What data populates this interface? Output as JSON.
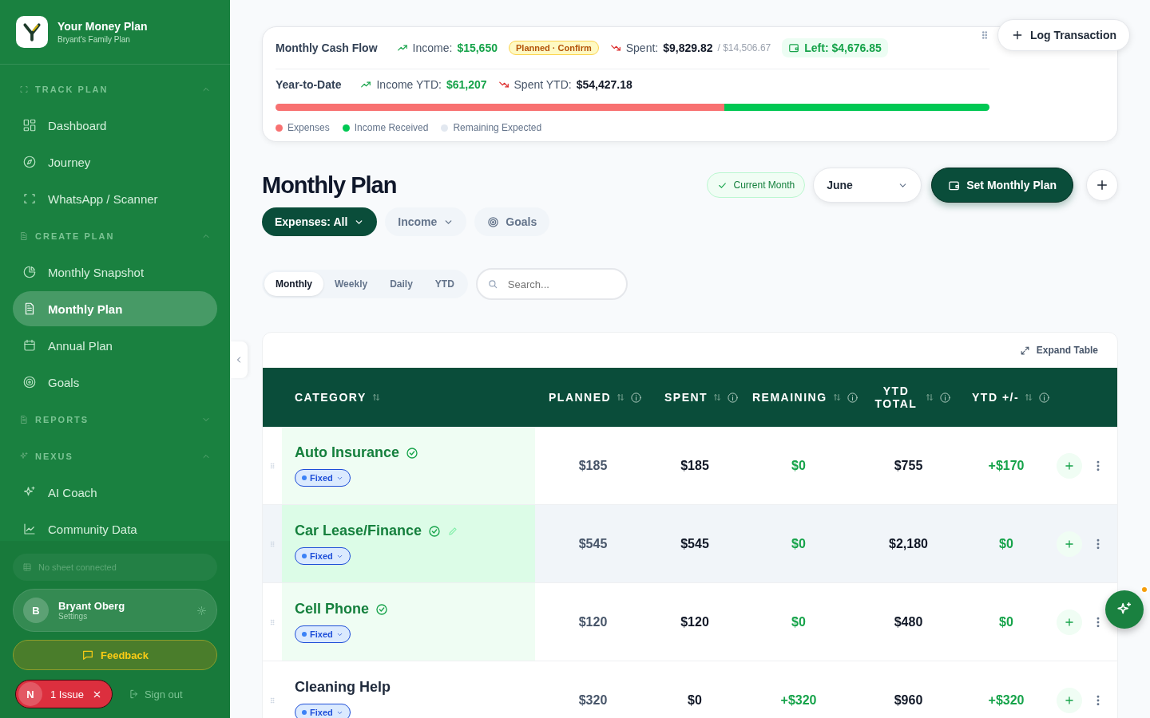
{
  "brand": {
    "title": "Your Money Plan",
    "subtitle": "Bryant's Family Plan"
  },
  "sidebar": {
    "sections": [
      {
        "title": "TRACK PLAN",
        "expanded": true,
        "items": [
          {
            "label": "Dashboard",
            "selected": false
          },
          {
            "label": "Journey",
            "selected": false
          },
          {
            "label": "WhatsApp / Scanner",
            "selected": false
          }
        ]
      },
      {
        "title": "CREATE PLAN",
        "expanded": true,
        "items": [
          {
            "label": "Monthly Snapshot",
            "selected": false
          },
          {
            "label": "Monthly Plan",
            "selected": true
          },
          {
            "label": "Annual Plan",
            "selected": false
          },
          {
            "label": "Goals",
            "selected": false
          }
        ]
      },
      {
        "title": "REPORTS",
        "expanded": false
      },
      {
        "title": "NEXUS",
        "expanded": true,
        "items": [
          {
            "label": "AI Coach",
            "selected": false
          },
          {
            "label": "Community Data",
            "selected": false
          }
        ]
      }
    ]
  },
  "sheet_status": "No sheet connected",
  "user": {
    "initial": "B",
    "name": "Bryant Oberg",
    "subtitle": "Settings"
  },
  "feedback_button": "Feedback",
  "issue_badge": {
    "initial": "N",
    "label": "1 Issue"
  },
  "sign_out": "Sign out",
  "cash_flow": {
    "monthly": {
      "title": "Monthly Cash Flow",
      "income_label": "Income:",
      "income": "$15,650",
      "income_badge": "Planned · Confirm",
      "spent_label": "Spent:",
      "spent": "$9,829.82",
      "spent_planned": "/ $14,506.67",
      "left": "Left: $4,676.85"
    },
    "ytd": {
      "title": "Year-to-Date",
      "income_label": "Income YTD:",
      "income": "$61,207",
      "spent_label": "Spent YTD:",
      "spent": "$54,427.18"
    },
    "legend": [
      {
        "label": "Expenses",
        "color": "#f87171",
        "level": 0.629
      },
      {
        "label": "Income Received",
        "color": "#00c853",
        "level": 0.371
      },
      {
        "label": "Remaining Expected",
        "color": "#e2e8f0",
        "level": 0
      }
    ]
  },
  "log_button": "Log Transaction",
  "page_title": "Monthly Plan",
  "current_month": "Current Month",
  "month_select": "June",
  "set_plan_button": "Set Monthly Plan",
  "filters": [
    {
      "label": "Expenses: All",
      "selected": true,
      "kind": "menu"
    },
    {
      "label": "Income",
      "selected": false,
      "kind": "menu"
    },
    {
      "label": "Goals",
      "selected": false,
      "kind": "link"
    }
  ],
  "views": [
    {
      "label": "Monthly",
      "selected": true
    },
    {
      "label": "Weekly",
      "selected": false
    },
    {
      "label": "Daily",
      "selected": false
    },
    {
      "label": "YTD",
      "selected": false
    }
  ],
  "search": {
    "placeholder": "Search..."
  },
  "expand_table": "Expand Table",
  "table": {
    "columns": [
      {
        "label": "CATEGORY",
        "info": false
      },
      {
        "label": "PLANNED",
        "info": true
      },
      {
        "label": "SPENT",
        "info": true
      },
      {
        "label": "REMAINING",
        "info": true
      },
      {
        "label": "YTD TOTAL",
        "info": true
      },
      {
        "label": "YTD +/-",
        "info": true
      }
    ],
    "rows": [
      {
        "name": "Auto Insurance",
        "type": "Fixed",
        "planned": "$185",
        "spent": "$185",
        "remaining": "$0",
        "ytd_total": "$755",
        "ytd_diff": "+$170",
        "done": true,
        "highlighted": false
      },
      {
        "name": "Car Lease/Finance",
        "type": "Fixed",
        "planned": "$545",
        "spent": "$545",
        "remaining": "$0",
        "ytd_total": "$2,180",
        "ytd_diff": "$0",
        "done": true,
        "highlighted": true
      },
      {
        "name": "Cell Phone",
        "type": "Fixed",
        "planned": "$120",
        "spent": "$120",
        "remaining": "$0",
        "ytd_total": "$480",
        "ytd_diff": "$0",
        "done": true,
        "highlighted": false
      },
      {
        "name": "Cleaning Help",
        "type": "Fixed",
        "planned": "$320",
        "spent": "$0",
        "remaining": "+$320",
        "ytd_total": "$960",
        "ytd_diff": "+$320",
        "done": false,
        "highlighted": false
      }
    ]
  },
  "assistant_button": {
    "notification": true
  }
}
